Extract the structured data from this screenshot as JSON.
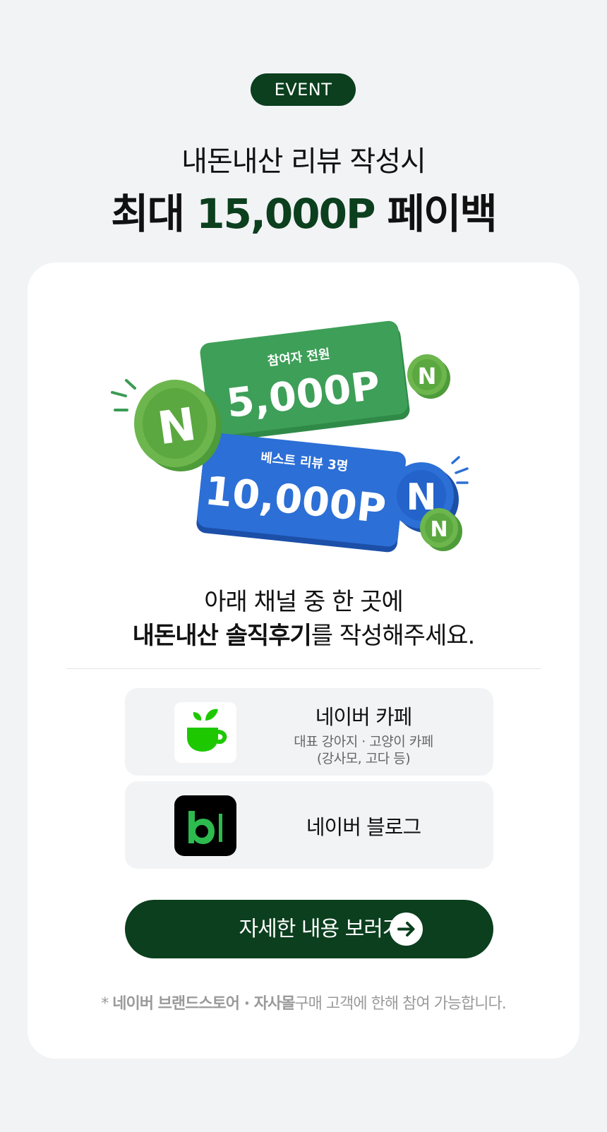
{
  "badge": "EVENT",
  "headline": {
    "line1": "내돈내산 리뷰 작성시",
    "prefix": "최대 ",
    "amount": "15,000P",
    "suffix": " 페이백"
  },
  "tickets": [
    {
      "caption": "참여자 전원",
      "amount": "5,000P",
      "color": "#3a9b54"
    },
    {
      "caption": "베스트 리뷰 3명",
      "amount": "10,000P",
      "color": "#2463c9"
    }
  ],
  "coin_letter": "N",
  "instruction": {
    "line1": "아래 채널 중 한 곳에",
    "bold": "내돈내산 솔직후기",
    "rest": "를 작성해주세요."
  },
  "channels": [
    {
      "name": "네이버 카페",
      "desc_line1": "대표 강아지 · 고양이 카페",
      "desc_line2": "(강사모, 고다 등)",
      "icon": "naver-cafe-icon"
    },
    {
      "name": "네이버 블로그",
      "icon": "naver-blog-icon"
    }
  ],
  "cta": {
    "label": "자세한 내용 보러가기",
    "icon": "arrow-right-icon"
  },
  "note": {
    "star": "* ",
    "bold": "네이버 브랜드스토어 · 자사몰",
    "rest": "구매 고객에 한해 참여 가능합니다."
  },
  "colors": {
    "brand_dark_green": "#0b3f1e",
    "bg": "#f2f3f5",
    "ticket_green": "#3a9b54",
    "ticket_blue": "#2463c9"
  }
}
